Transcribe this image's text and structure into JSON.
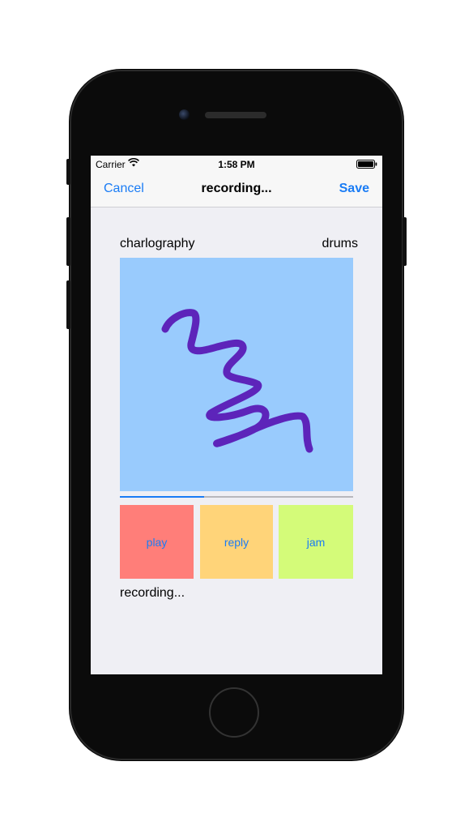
{
  "status_bar": {
    "carrier": "Carrier",
    "time": "1:58 PM",
    "wifi_icon": "wifi-icon",
    "battery_icon": "battery-icon"
  },
  "nav": {
    "cancel_label": "Cancel",
    "title": "recording...",
    "save_label": "Save"
  },
  "main": {
    "name_label": "charlography",
    "instrument_label": "drums",
    "canvas_background": "#99cbfd",
    "stroke_color": "#5d24ba",
    "progress_fraction": 0.36,
    "buttons": [
      {
        "label": "play",
        "color": "#ff7e79"
      },
      {
        "label": "reply",
        "color": "#ffd479"
      },
      {
        "label": "jam",
        "color": "#d4fb79"
      }
    ],
    "status_text": "recording..."
  },
  "accent_color": "#1a7cf5"
}
